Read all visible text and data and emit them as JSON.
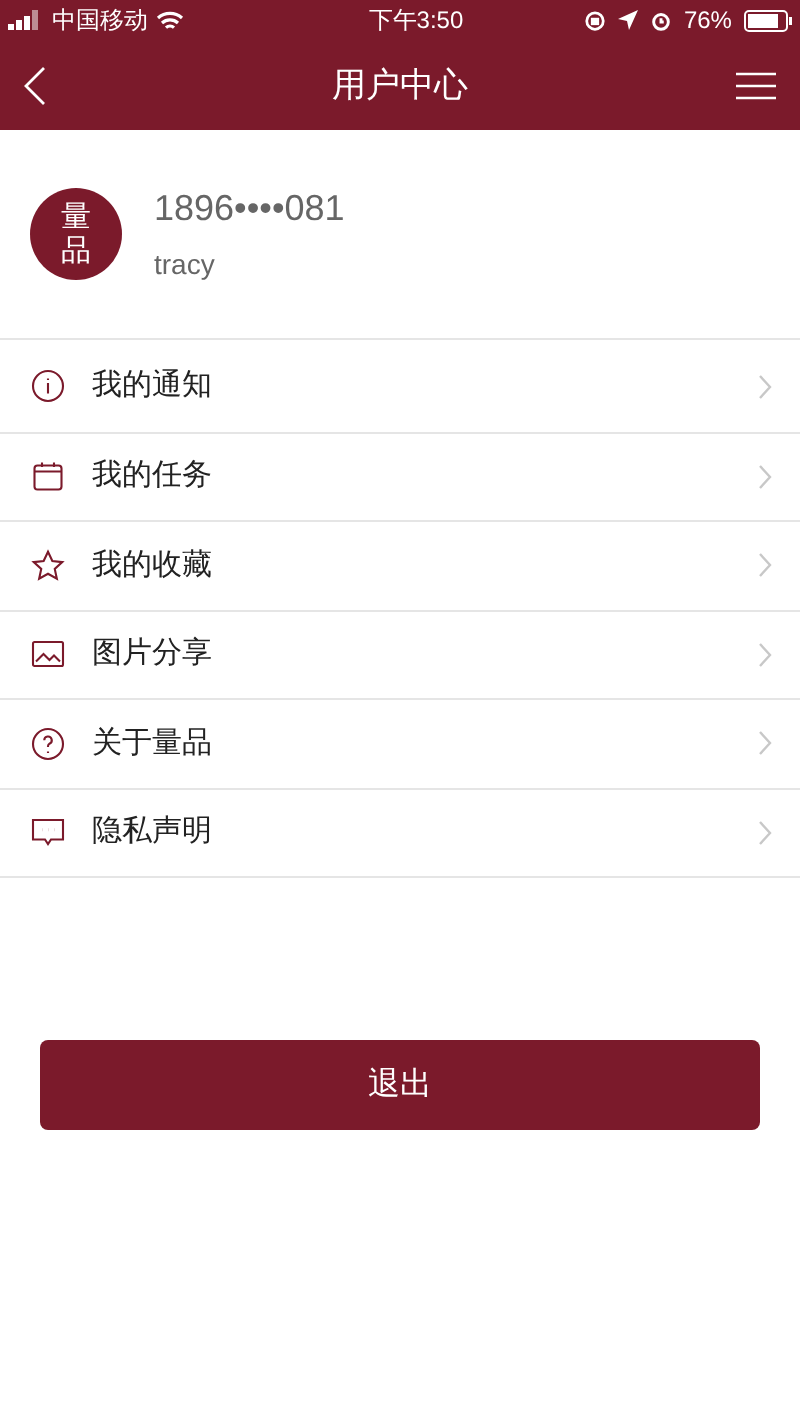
{
  "status_bar": {
    "carrier": "中国移动",
    "time": "下午3:50",
    "battery": "76%"
  },
  "nav": {
    "title": "用户中心"
  },
  "profile": {
    "avatar": "量品",
    "phone": "1896••••081",
    "name": "tracy"
  },
  "menu": [
    {
      "kind": "info",
      "label": "我的通知"
    },
    {
      "kind": "calendar",
      "label": "我的任务"
    },
    {
      "kind": "star",
      "label": "我的收藏"
    },
    {
      "kind": "image",
      "label": "图片分享"
    },
    {
      "kind": "help",
      "label": "关于量品"
    },
    {
      "kind": "message",
      "label": "隐私声明"
    }
  ],
  "logout": {
    "label": "退出"
  }
}
